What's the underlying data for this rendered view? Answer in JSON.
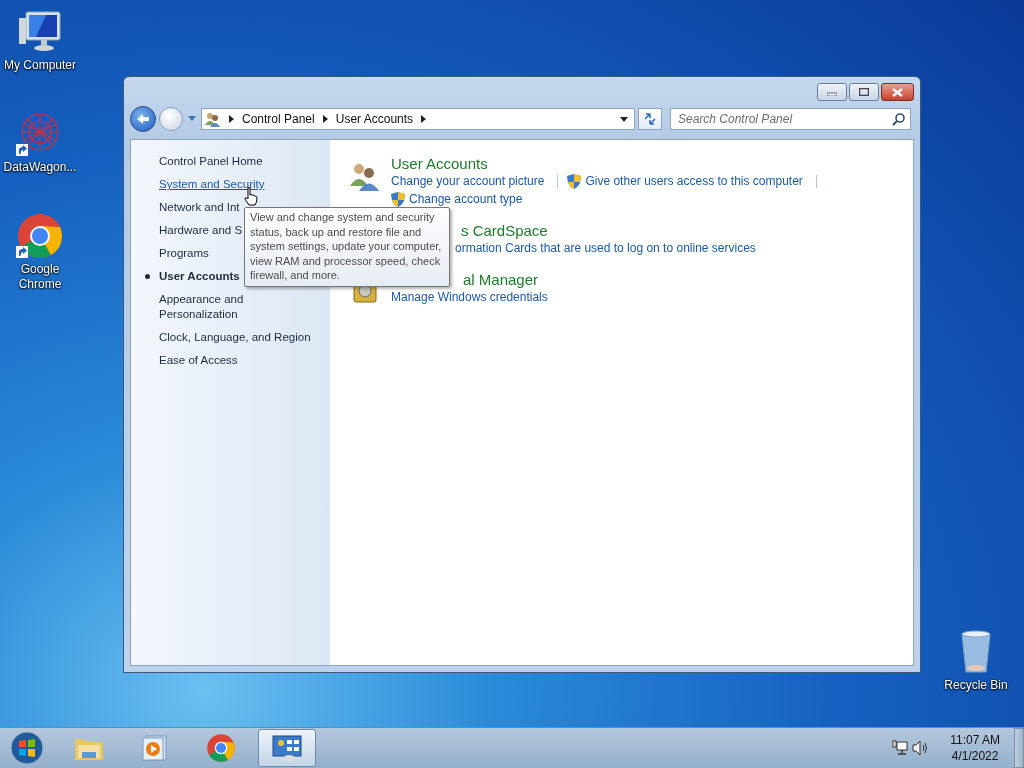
{
  "desktop_icons": [
    {
      "label": "My Computer",
      "kind": "computer",
      "shortcut": false
    },
    {
      "label": "DataWagon...",
      "kind": "datawagon",
      "shortcut": true
    },
    {
      "label": "Google Chrome",
      "kind": "chrome",
      "shortcut": true
    },
    {
      "label": "Recycle Bin",
      "kind": "recycle",
      "shortcut": false
    }
  ],
  "window": {
    "breadcrumb": [
      "Control Panel",
      "User Accounts"
    ],
    "search": {
      "placeholder": "Search Control Panel"
    }
  },
  "sidebar": {
    "items": [
      {
        "label": "Control Panel Home",
        "selected": false,
        "hovered": false
      },
      {
        "label": "System and Security",
        "selected": false,
        "hovered": true
      },
      {
        "label": "Network and Int",
        "selected": false,
        "hovered": false
      },
      {
        "label": "Hardware and S",
        "selected": false,
        "hovered": false
      },
      {
        "label": "Programs",
        "selected": false,
        "hovered": false
      },
      {
        "label": "User Accounts",
        "selected": true,
        "hovered": false
      },
      {
        "label": "Appearance and Personalization",
        "selected": false,
        "hovered": false
      },
      {
        "label": "Clock, Language, and Region",
        "selected": false,
        "hovered": false
      },
      {
        "label": "Ease of Access",
        "selected": false,
        "hovered": false
      }
    ]
  },
  "sections": [
    {
      "kind": "users",
      "title": "User Accounts",
      "links": [
        {
          "label": "Change your account picture",
          "shield": false
        },
        {
          "label": "Give other users access to this computer",
          "shield": true
        },
        {
          "label": "Change account type",
          "shield": true
        }
      ]
    },
    {
      "kind": "cardspace",
      "title": "s CardSpace",
      "links": [
        {
          "label": "ormation Cards that are used to log on to online services",
          "shield": false
        }
      ]
    },
    {
      "kind": "credential",
      "title": "al Manager",
      "links": [
        {
          "label": "Manage Windows credentials",
          "shield": false
        }
      ]
    }
  ],
  "tooltip": {
    "text": "View and change system and security status, back up and restore file and system settings, update your computer, view RAM and processor speed, check firewall, and more."
  },
  "taskbar": {
    "items": [
      {
        "kind": "start",
        "selected": false
      },
      {
        "kind": "explorer",
        "selected": false
      },
      {
        "kind": "media",
        "selected": false
      },
      {
        "kind": "chrome",
        "selected": false
      },
      {
        "kind": "controlpanel",
        "selected": true
      }
    ],
    "time": "11:07 AM",
    "date": "4/1/2022"
  }
}
